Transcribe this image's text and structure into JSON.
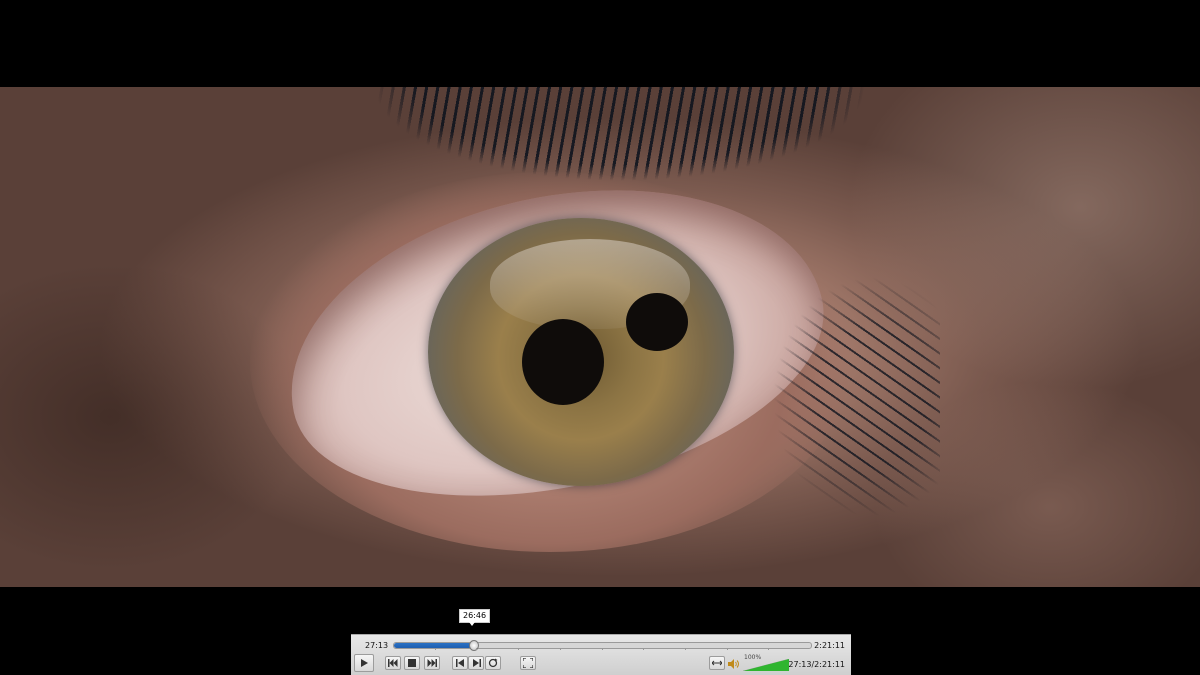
{
  "tooltip": {
    "time": "26:46"
  },
  "controller": {
    "elapsed": "27:13",
    "duration": "2:21:11",
    "seek_progress": 0.19,
    "volume_label": "100%",
    "volume_level": 1.0,
    "time_combo": "27:13/2:21:11",
    "accent_color": "#2a71c4",
    "volume_color": "#2fb52f"
  },
  "icons": {
    "play": "play-icon",
    "prev": "skip-back-icon",
    "stop": "stop-icon",
    "next": "skip-forward-icon",
    "frame_back": "frame-back-icon",
    "frame_fwd": "frame-forward-icon",
    "loop": "loop-icon",
    "fullscreen": "fullscreen-icon",
    "ext": "extended-settings-icon",
    "volume": "speaker-icon"
  }
}
